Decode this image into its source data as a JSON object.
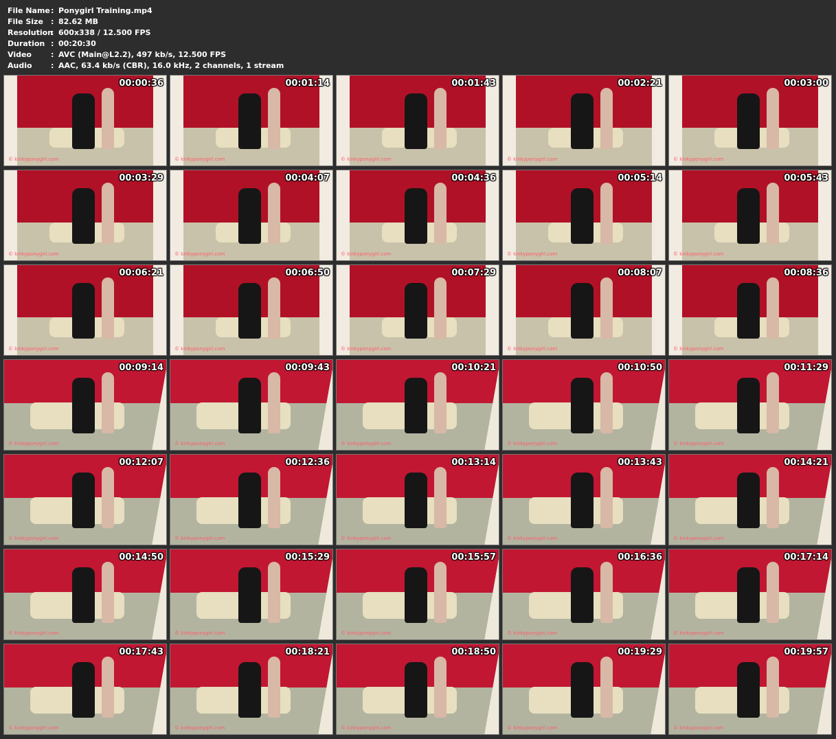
{
  "info": [
    {
      "label": "File Name",
      "value": "Ponygirl Training.mp4"
    },
    {
      "label": "File Size",
      "value": "82.62 MB"
    },
    {
      "label": "Resolution",
      "value": "600x338 / 12.500 FPS"
    },
    {
      "label": "Duration",
      "value": "00:20:30"
    },
    {
      "label": "Video",
      "value": "AVC (Main@L2.2), 497 kb/s, 12.500 FPS"
    },
    {
      "label": "Audio",
      "value": "AAC, 63.4 kb/s (CBR), 16.0 kHz, 2 channels, 1 stream"
    }
  ],
  "separator": ":",
  "watermark": "© kinkyponygirl.com",
  "thumbnails": [
    {
      "time": "00:00:36",
      "scene": "a"
    },
    {
      "time": "00:01:14",
      "scene": "a"
    },
    {
      "time": "00:01:43",
      "scene": "a"
    },
    {
      "time": "00:02:21",
      "scene": "a"
    },
    {
      "time": "00:03:00",
      "scene": "a"
    },
    {
      "time": "00:03:29",
      "scene": "a"
    },
    {
      "time": "00:04:07",
      "scene": "a"
    },
    {
      "time": "00:04:36",
      "scene": "a"
    },
    {
      "time": "00:05:14",
      "scene": "a"
    },
    {
      "time": "00:05:43",
      "scene": "a"
    },
    {
      "time": "00:06:21",
      "scene": "a"
    },
    {
      "time": "00:06:50",
      "scene": "a"
    },
    {
      "time": "00:07:29",
      "scene": "a"
    },
    {
      "time": "00:08:07",
      "scene": "a"
    },
    {
      "time": "00:08:36",
      "scene": "a"
    },
    {
      "time": "00:09:14",
      "scene": "b"
    },
    {
      "time": "00:09:43",
      "scene": "b"
    },
    {
      "time": "00:10:21",
      "scene": "b"
    },
    {
      "time": "00:10:50",
      "scene": "b"
    },
    {
      "time": "00:11:29",
      "scene": "b"
    },
    {
      "time": "00:12:07",
      "scene": "b"
    },
    {
      "time": "00:12:36",
      "scene": "b"
    },
    {
      "time": "00:13:14",
      "scene": "b"
    },
    {
      "time": "00:13:43",
      "scene": "b"
    },
    {
      "time": "00:14:21",
      "scene": "b"
    },
    {
      "time": "00:14:50",
      "scene": "b"
    },
    {
      "time": "00:15:29",
      "scene": "b"
    },
    {
      "time": "00:15:57",
      "scene": "b"
    },
    {
      "time": "00:16:36",
      "scene": "b"
    },
    {
      "time": "00:17:14",
      "scene": "b"
    },
    {
      "time": "00:17:43",
      "scene": "b"
    },
    {
      "time": "00:18:21",
      "scene": "b"
    },
    {
      "time": "00:18:50",
      "scene": "b"
    },
    {
      "time": "00:19:29",
      "scene": "b"
    },
    {
      "time": "00:19:57",
      "scene": "b"
    }
  ]
}
